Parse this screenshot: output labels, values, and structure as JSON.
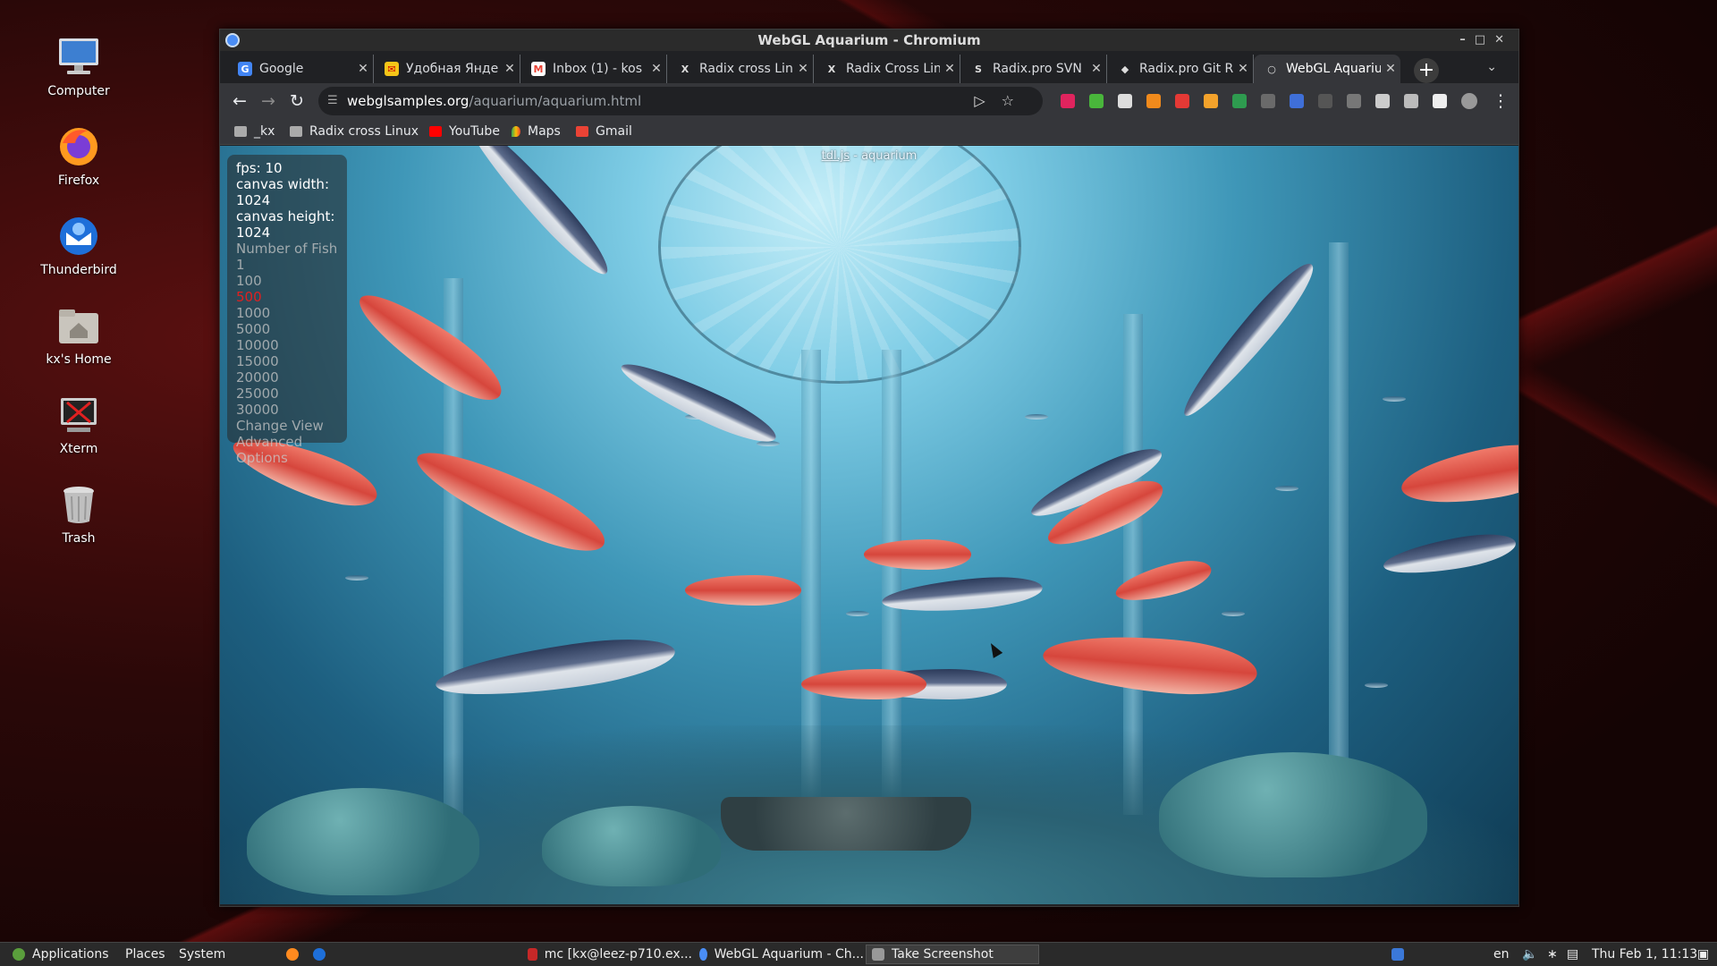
{
  "desktop": {
    "icons": [
      {
        "label": "Computer",
        "icon": "computer-icon"
      },
      {
        "label": "Firefox",
        "icon": "firefox-icon"
      },
      {
        "label": "Thunderbird",
        "icon": "thunderbird-icon"
      },
      {
        "label": "kx's Home",
        "icon": "home-folder-icon"
      },
      {
        "label": "Xterm",
        "icon": "terminal-icon"
      },
      {
        "label": "Trash",
        "icon": "trash-icon"
      }
    ]
  },
  "window": {
    "title": "WebGL Aquarium - Chromium",
    "tabs": [
      {
        "label": "Google",
        "favicon": "google-icon",
        "color": "#4285f4"
      },
      {
        "label": "Удобная Янде",
        "favicon": "yandex-mail-icon",
        "color": "#f5c518"
      },
      {
        "label": "Inbox (1) - kos",
        "favicon": "gmail-icon",
        "color": "#ea4335"
      },
      {
        "label": "Radix cross Lin",
        "favicon": "radix-icon",
        "color": "#888888"
      },
      {
        "label": "Radix Cross Lin",
        "favicon": "radix-icon",
        "color": "#888888"
      },
      {
        "label": "Radix.pro SVN",
        "favicon": "svn-icon",
        "color": "#aaaaaa"
      },
      {
        "label": "Radix.pro Git R",
        "favicon": "git-icon",
        "color": "#aaaaaa"
      },
      {
        "label": "WebGL Aquariu",
        "favicon": "globe-icon",
        "color": "#bbbbbb"
      }
    ],
    "address": {
      "domain": "webglsamples.org",
      "path": "/aquarium/aquarium.html"
    },
    "bookmarks": [
      {
        "label": "_kx",
        "icon": "folder-icon"
      },
      {
        "label": "Radix cross Linux",
        "icon": "folder-icon"
      },
      {
        "label": "YouTube",
        "icon": "youtube-icon"
      },
      {
        "label": "Maps",
        "icon": "maps-icon"
      },
      {
        "label": "Gmail",
        "icon": "gmail-icon"
      }
    ]
  },
  "page": {
    "overlay_link": "tdl.js",
    "overlay_title": " - aquarium",
    "stats": {
      "fps": "fps: 10",
      "canvas_width": "canvas width: 1024",
      "canvas_height": "canvas height: 1024"
    },
    "fish_menu_label": "Number of Fish",
    "fish_counts": [
      "1",
      "100",
      "500",
      "1000",
      "5000",
      "10000",
      "15000",
      "20000",
      "25000",
      "30000"
    ],
    "selected_fish_count": "500",
    "menu_items": [
      "Change View",
      "Advanced",
      "Options"
    ]
  },
  "taskbar": {
    "menus": [
      "Applications",
      "Places",
      "System"
    ],
    "windows": [
      {
        "label": "mc [kx@leez-p710.ex...",
        "icon": "terminal-icon"
      },
      {
        "label": "WebGL Aquarium - Ch...",
        "icon": "chromium-icon"
      },
      {
        "label": "Take Screenshot",
        "icon": "screenshot-icon"
      }
    ],
    "keyboard_layout": "en",
    "clock": "Thu Feb  1, 11:13"
  },
  "colors": {
    "selected_fish": "#e02020",
    "chrome_dark": "#202124",
    "toolbar": "#35363a"
  }
}
